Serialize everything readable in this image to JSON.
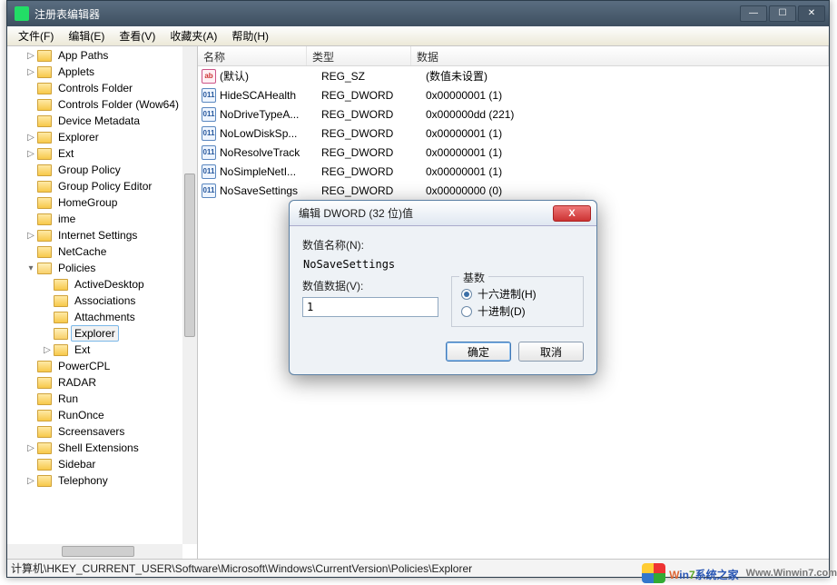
{
  "window": {
    "title": "注册表编辑器"
  },
  "menu": {
    "file": "文件(F)",
    "edit": "编辑(E)",
    "view": "查看(V)",
    "fav": "收藏夹(A)",
    "help": "帮助(H)"
  },
  "tree": [
    {
      "depth": 0,
      "exp": "▷",
      "label": "App Paths"
    },
    {
      "depth": 0,
      "exp": "▷",
      "label": "Applets"
    },
    {
      "depth": 0,
      "exp": "",
      "label": "Controls Folder"
    },
    {
      "depth": 0,
      "exp": "",
      "label": "Controls Folder (Wow64)"
    },
    {
      "depth": 0,
      "exp": "",
      "label": "Device Metadata"
    },
    {
      "depth": 0,
      "exp": "▷",
      "label": "Explorer"
    },
    {
      "depth": 0,
      "exp": "▷",
      "label": "Ext"
    },
    {
      "depth": 0,
      "exp": "",
      "label": "Group Policy"
    },
    {
      "depth": 0,
      "exp": "",
      "label": "Group Policy Editor"
    },
    {
      "depth": 0,
      "exp": "",
      "label": "HomeGroup"
    },
    {
      "depth": 0,
      "exp": "",
      "label": "ime"
    },
    {
      "depth": 0,
      "exp": "▷",
      "label": "Internet Settings"
    },
    {
      "depth": 0,
      "exp": "",
      "label": "NetCache"
    },
    {
      "depth": 0,
      "exp": "▾",
      "label": "Policies",
      "open": true
    },
    {
      "depth": 1,
      "exp": "",
      "label": "ActiveDesktop"
    },
    {
      "depth": 1,
      "exp": "",
      "label": "Associations"
    },
    {
      "depth": 1,
      "exp": "",
      "label": "Attachments"
    },
    {
      "depth": 1,
      "exp": "",
      "label": "Explorer",
      "sel": true,
      "open": true
    },
    {
      "depth": 1,
      "exp": "▷",
      "label": "Ext"
    },
    {
      "depth": 0,
      "exp": "",
      "label": "PowerCPL"
    },
    {
      "depth": 0,
      "exp": "",
      "label": "RADAR"
    },
    {
      "depth": 0,
      "exp": "",
      "label": "Run"
    },
    {
      "depth": 0,
      "exp": "",
      "label": "RunOnce"
    },
    {
      "depth": 0,
      "exp": "",
      "label": "Screensavers"
    },
    {
      "depth": 0,
      "exp": "▷",
      "label": "Shell Extensions"
    },
    {
      "depth": 0,
      "exp": "",
      "label": "Sidebar"
    },
    {
      "depth": 0,
      "exp": "▷",
      "label": "Telephony"
    }
  ],
  "columns": {
    "name": "名称",
    "type": "类型",
    "data": "数据"
  },
  "values": [
    {
      "icon": "sz",
      "name": "(默认)",
      "type": "REG_SZ",
      "data": "(数值未设置)"
    },
    {
      "icon": "bin",
      "name": "HideSCAHealth",
      "type": "REG_DWORD",
      "data": "0x00000001 (1)"
    },
    {
      "icon": "bin",
      "name": "NoDriveTypeA...",
      "type": "REG_DWORD",
      "data": "0x000000dd (221)"
    },
    {
      "icon": "bin",
      "name": "NoLowDiskSp...",
      "type": "REG_DWORD",
      "data": "0x00000001 (1)"
    },
    {
      "icon": "bin",
      "name": "NoResolveTrack",
      "type": "REG_DWORD",
      "data": "0x00000001 (1)"
    },
    {
      "icon": "bin",
      "name": "NoSimpleNetI...",
      "type": "REG_DWORD",
      "data": "0x00000001 (1)"
    },
    {
      "icon": "bin",
      "name": "NoSaveSettings",
      "type": "REG_DWORD",
      "data": "0x00000000 (0)"
    }
  ],
  "status": "计算机\\HKEY_CURRENT_USER\\Software\\Microsoft\\Windows\\CurrentVersion\\Policies\\Explorer",
  "dialog": {
    "title": "编辑 DWORD (32 位)值",
    "name_label": "数值名称(N):",
    "name_value": "NoSaveSettings",
    "data_label": "数值数据(V):",
    "data_value": "1",
    "base_legend": "基数",
    "radio_hex": "十六进制(H)",
    "radio_dec": "十进制(D)",
    "ok": "确定",
    "cancel": "取消"
  },
  "watermark": {
    "brand_a": "W",
    "brand_b": "in",
    "brand_c": "7",
    "brand_d": "系统之家",
    "url": "Www.Winwin7.com"
  }
}
